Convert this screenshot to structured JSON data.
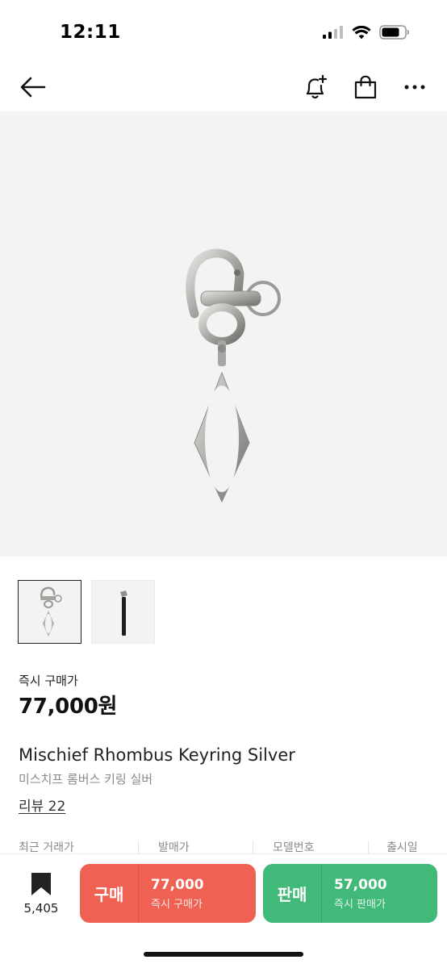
{
  "status_bar": {
    "time": "12:11"
  },
  "product": {
    "price_label": "즉시 구매가",
    "price": "77,000원",
    "name": "Mischief Rhombus Keyring Silver",
    "name_ko": "미스치프 롬버스 키링 실버",
    "review_link": "리뷰 22"
  },
  "info_headers": [
    "최근 거래가",
    "발매가",
    "모델번호",
    "출시일"
  ],
  "bottom_bar": {
    "wish_count": "5,405",
    "buy": {
      "label": "구매",
      "price": "77,000",
      "sub": "즉시 구매가",
      "color": "#ef6253"
    },
    "sell": {
      "label": "판매",
      "price": "57,000",
      "sub": "즉시 판매가",
      "color": "#41b979"
    }
  },
  "icons": {
    "nav": [
      "back-arrow-icon",
      "bell-plus-icon",
      "shopping-bag-icon",
      "more-icon"
    ],
    "wish": "bookmark-icon"
  }
}
